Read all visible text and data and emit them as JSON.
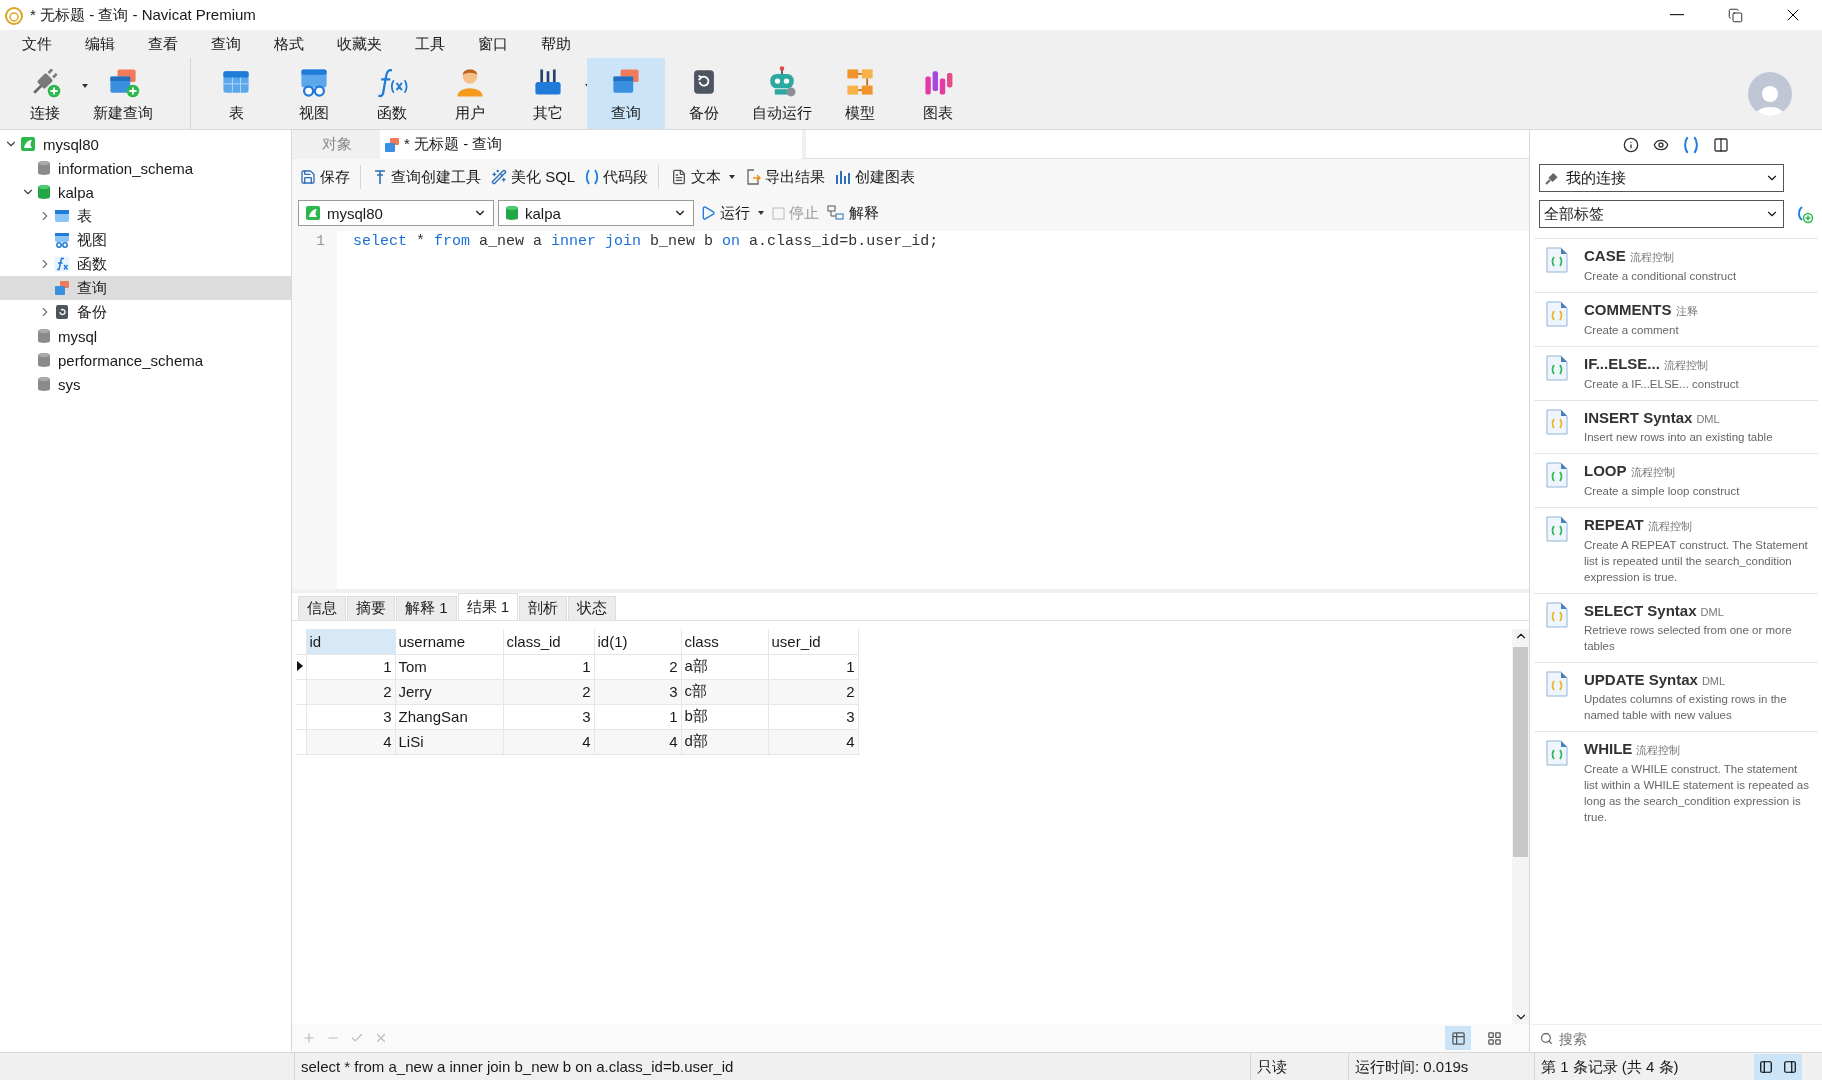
{
  "window": {
    "title": "* 无标题 - 查询 - Navicat Premium"
  },
  "menu": [
    "文件",
    "编辑",
    "查看",
    "查询",
    "格式",
    "收藏夹",
    "工具",
    "窗口",
    "帮助"
  ],
  "toolbar": {
    "groups": [
      [
        {
          "label": "连接",
          "kind": "connect",
          "dropdown": true,
          "selected": false
        },
        {
          "label": "新建查询",
          "kind": "newquery",
          "dropdown": false,
          "selected": false
        }
      ],
      [
        {
          "label": "表",
          "kind": "table",
          "dropdown": false,
          "selected": false
        },
        {
          "label": "视图",
          "kind": "view",
          "dropdown": false,
          "selected": false
        },
        {
          "label": "函数",
          "kind": "function",
          "dropdown": false,
          "selected": false
        },
        {
          "label": "用户",
          "kind": "user",
          "dropdown": false,
          "selected": false
        },
        {
          "label": "其它",
          "kind": "other",
          "dropdown": true,
          "selected": false
        },
        {
          "label": "查询",
          "kind": "query",
          "dropdown": false,
          "selected": true
        },
        {
          "label": "备份",
          "kind": "backup",
          "dropdown": false,
          "selected": false
        },
        {
          "label": "自动运行",
          "kind": "robot",
          "dropdown": false,
          "selected": false
        },
        {
          "label": "模型",
          "kind": "model",
          "dropdown": false,
          "selected": false
        },
        {
          "label": "图表",
          "kind": "chart",
          "dropdown": false,
          "selected": false
        }
      ]
    ]
  },
  "tree": [
    {
      "label": "mysql80",
      "kind": "connection",
      "open": true,
      "expanded": true,
      "selected": false,
      "children": [
        {
          "label": "information_schema",
          "kind": "database",
          "open": false,
          "selected": false
        },
        {
          "label": "kalpa",
          "kind": "database",
          "open": true,
          "expanded": true,
          "selected": false,
          "children": [
            {
              "label": "表",
              "kind": "tables",
              "expanded": false,
              "selected": false
            },
            {
              "label": "视图",
              "kind": "views",
              "selected": false
            },
            {
              "label": "函数",
              "kind": "functions",
              "expanded": false,
              "selected": false
            },
            {
              "label": "查询",
              "kind": "queries",
              "selected": true
            },
            {
              "label": "备份",
              "kind": "backups",
              "expanded": false,
              "selected": false
            }
          ]
        },
        {
          "label": "mysql",
          "kind": "database",
          "open": false,
          "selected": false
        },
        {
          "label": "performance_schema",
          "kind": "database",
          "open": false,
          "selected": false
        },
        {
          "label": "sys",
          "kind": "database",
          "open": false,
          "selected": false
        }
      ]
    }
  ],
  "tabs": [
    {
      "label": "对象",
      "selected": false
    },
    {
      "label": "* 无标题 - 查询",
      "selected": true
    }
  ],
  "editor_toolbar": {
    "groups": [
      [
        {
          "label": "保存",
          "kind": "save",
          "dropdown": false
        }
      ],
      [
        {
          "label": "查询创建工具",
          "kind": "builder",
          "dropdown": false
        },
        {
          "label": "美化 SQL",
          "kind": "wand",
          "dropdown": false
        },
        {
          "label": "代码段",
          "kind": "braces",
          "dropdown": false
        }
      ],
      [
        {
          "label": "文本",
          "kind": "doc",
          "dropdown": true
        },
        {
          "label": "导出结果",
          "kind": "export",
          "dropdown": false
        },
        {
          "label": "创建图表",
          "kind": "chart",
          "dropdown": false
        }
      ]
    ]
  },
  "connection_select": {
    "value": "mysql80"
  },
  "database_select": {
    "value": "kalpa"
  },
  "run_controls": [
    {
      "label": "运行",
      "kind": "play",
      "disabled": false,
      "dropdown": true
    },
    {
      "label": "停止",
      "kind": "box",
      "disabled": true,
      "dropdown": false
    },
    {
      "label": "解释",
      "kind": "explain",
      "disabled": false,
      "dropdown": false
    }
  ],
  "editor": {
    "lines": [
      {
        "number": "1",
        "tokens": [
          {
            "text": "select",
            "kind": "keyword"
          },
          {
            "text": " * ",
            "kind": "plain"
          },
          {
            "text": "from",
            "kind": "keyword"
          },
          {
            "text": " a_new a ",
            "kind": "plain"
          },
          {
            "text": "inner join",
            "kind": "keyword"
          },
          {
            "text": " b_new b ",
            "kind": "plain"
          },
          {
            "text": "on",
            "kind": "keyword"
          },
          {
            "text": " a.class_id=b.user_id;",
            "kind": "plain"
          }
        ]
      }
    ]
  },
  "result_tabs": [
    {
      "label": "信息",
      "selected": false
    },
    {
      "label": "摘要",
      "selected": false
    },
    {
      "label": "解释 1",
      "selected": false
    },
    {
      "label": "结果 1",
      "selected": true
    },
    {
      "label": "剖析",
      "selected": false
    },
    {
      "label": "状态",
      "selected": false
    }
  ],
  "table": {
    "columns": [
      {
        "label": "id",
        "kind": "number",
        "selected": true
      },
      {
        "label": "username",
        "kind": "text",
        "selected": false
      },
      {
        "label": "class_id",
        "kind": "number",
        "selected": false
      },
      {
        "label": "id(1)",
        "kind": "number",
        "selected": false
      },
      {
        "label": "class",
        "kind": "text",
        "selected": false
      },
      {
        "label": "user_id",
        "kind": "number",
        "selected": false
      }
    ],
    "rows": [
      {
        "selected": true,
        "cells": [
          "1",
          "Tom",
          "1",
          "2",
          "a部",
          "1"
        ]
      },
      {
        "selected": false,
        "cells": [
          "2",
          "Jerry",
          "2",
          "3",
          "c部",
          "2"
        ]
      },
      {
        "selected": false,
        "cells": [
          "3",
          "ZhangSan",
          "3",
          "1",
          "b部",
          "3"
        ]
      },
      {
        "selected": false,
        "cells": [
          "4",
          "LiSi",
          "4",
          "4",
          "d部",
          "4"
        ]
      }
    ]
  },
  "view_modes": [
    {
      "kind": "grid",
      "selected": true
    },
    {
      "kind": "form",
      "selected": false
    }
  ],
  "side_panel": {
    "tabs": [
      {
        "kind": "info",
        "selected": false
      },
      {
        "kind": "eye",
        "selected": false
      },
      {
        "kind": "braces",
        "selected": true
      },
      {
        "kind": "grid",
        "selected": false
      }
    ],
    "connection": "我的连接",
    "tag": "全部标签",
    "snippets": [
      {
        "title": "CASE",
        "tag": "流程控制",
        "description": "Create a conditional construct",
        "kind": "control"
      },
      {
        "title": "COMMENTS",
        "tag": "注释",
        "description": "Create a comment",
        "kind": "statement"
      },
      {
        "title": "IF...ELSE...",
        "tag": "流程控制",
        "description": "Create a IF...ELSE... construct",
        "kind": "control"
      },
      {
        "title": "INSERT Syntax",
        "tag": "DML",
        "description": "Insert new rows into an existing table",
        "kind": "statement"
      },
      {
        "title": "LOOP",
        "tag": "流程控制",
        "description": "Create a simple loop construct",
        "kind": "control"
      },
      {
        "title": "REPEAT",
        "tag": "流程控制",
        "description": "Create A REPEAT construct. The Statement list is repeated until the search_condition expression is true.",
        "kind": "control"
      },
      {
        "title": "SELECT Syntax",
        "tag": "DML",
        "description": "Retrieve rows selected from one or more tables",
        "kind": "statement"
      },
      {
        "title": "UPDATE Syntax",
        "tag": "DML",
        "description": "Updates columns of existing rows in the named table with new values",
        "kind": "statement"
      },
      {
        "title": "WHILE",
        "tag": "流程控制",
        "description": "Create a WHILE construct. The statement list within a WHILE statement is repeated as long as the search_condition expression is true.",
        "kind": "control"
      }
    ],
    "search": {
      "placeholder": "搜索"
    }
  },
  "status_bar": {
    "sql": "select * from a_new a inner join b_new b on a.class_id=b.user_id",
    "mode": "只读",
    "time": "运行时间: 0.019s",
    "records": "第 1 条记录 (共 4 条)",
    "panels": [
      {
        "kind": "left",
        "selected": true
      },
      {
        "kind": "right",
        "selected": true
      }
    ]
  }
}
